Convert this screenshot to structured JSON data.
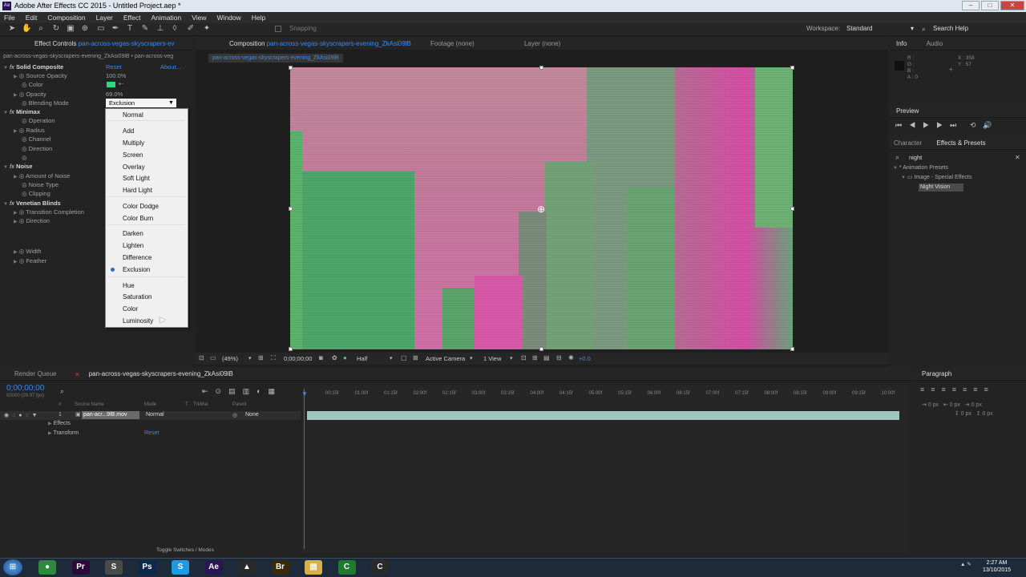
{
  "window": {
    "title": "Adobe After Effects CC 2015 - Untitled Project.aep *",
    "ae_glyph": "Ae"
  },
  "window_buttons": [
    "–",
    "□",
    "✕"
  ],
  "menu": [
    "File",
    "Edit",
    "Composition",
    "Layer",
    "Effect",
    "Animation",
    "View",
    "Window",
    "Help"
  ],
  "toolbar": {
    "snapping": "Snapping",
    "workspace_label": "Workspace:",
    "workspace_value": "Standard",
    "search_help": "Search Help"
  },
  "effect_controls": {
    "tab": "Effect Controls",
    "tab_file": "pan-across-vegas-skyscrapers-ev",
    "subtitle": "pan-across-vegas-skyscrapers-evening_ZkAsi09lB • pan-across-veg",
    "solid": {
      "name": "Solid Composite",
      "reset": "Reset",
      "about": "About...",
      "source_opacity_label": "Source Opacity",
      "source_opacity": "100.0%",
      "color_label": "Color",
      "opacity_label": "Opacity",
      "opacity": "69.0%",
      "blend_label": "Blending Mode",
      "blend_value": "Exclusion"
    },
    "minimax": {
      "name": "Minimax",
      "items": [
        "Operation",
        "Radius",
        "Channel",
        "Direction"
      ]
    },
    "noise": {
      "name": "Noise",
      "items": [
        "Amount of Noise",
        "Noise Type",
        "Clipping"
      ]
    },
    "venetian": {
      "name": "Venetian Blinds",
      "items": [
        "Transition Completion",
        "Direction",
        "Width",
        "Feather"
      ]
    }
  },
  "blend_menu": {
    "items": [
      "Normal",
      "Add",
      "Multiply",
      "Screen",
      "Overlay",
      "Soft Light",
      "Hard Light",
      "Color Dodge",
      "Color Burn",
      "Darken",
      "Lighten",
      "Difference",
      "Exclusion",
      "Hue",
      "Saturation",
      "Color",
      "Luminosity"
    ],
    "selected": "Exclusion"
  },
  "comp": {
    "tab_label": "Composition",
    "tab_file": "pan-across-vegas-skyscrapers-evening_ZkAsi09lB",
    "footage": "Footage (none)",
    "layer": "Layer (none)",
    "crumb": "pan-across-vegas-skyscrapers-evening_ZkAsi09lB",
    "zoom": "(49%)",
    "timecode": "0;00;00;00",
    "resolution": "Half",
    "camera": "Active Camera",
    "views": "1 View",
    "exposure": "+0.0"
  },
  "info": {
    "tab": "Info",
    "audio": "Audio",
    "r": "R :",
    "g": "G :",
    "b": "B :",
    "a": "A : 0",
    "x": "X : 358",
    "y": "Y : 57"
  },
  "preview": {
    "tab": "Preview"
  },
  "effects_presets": {
    "character": "Character",
    "tab": "Effects & Presets",
    "search": "night",
    "tree": [
      "* Animation Presets",
      "Image - Special Effects",
      "Night Vision"
    ]
  },
  "timeline": {
    "render_queue": "Render Queue",
    "tab": "pan-across-vegas-skyscrapers-evening_ZkAsi09lB",
    "timecode": "0;00;00;00",
    "fps": "00000 (29.97 fps)",
    "cols": [
      "#",
      "Source Name",
      "Mode",
      "T",
      "TrkMat",
      "Parent"
    ],
    "layer_num": "1",
    "layer_name": "pan-acr...9lB.mov",
    "mode": "Normal",
    "parent": "None",
    "sub": [
      "Effects",
      "Transform"
    ],
    "reset": "Reset",
    "toggle": "Toggle Switches / Modes",
    "ruler": [
      "00:15f",
      "01:00f",
      "01:15f",
      "02:00f",
      "02:15f",
      "03:00f",
      "03:15f",
      "04:00f",
      "04:15f",
      "05:00f",
      "05:15f",
      "06:00f",
      "06:15f",
      "07:00f",
      "07:15f",
      "08:00f",
      "08:15f",
      "09:00f",
      "09:15f",
      "10:00f"
    ]
  },
  "paragraph": {
    "tab": "Paragraph",
    "px": [
      "0 px",
      "0 px",
      "0 px",
      "0 px",
      "0 px"
    ]
  },
  "taskbar": {
    "time": "2:27 AM",
    "date": "13/10/2015",
    "apps": [
      {
        "name": "chrome",
        "label": "●",
        "color": "#2b8a3e"
      },
      {
        "name": "premiere",
        "label": "Pr",
        "color": "#2a0a3a"
      },
      {
        "name": "sublime",
        "label": "S",
        "color": "#4a4a4a"
      },
      {
        "name": "photoshop",
        "label": "Ps",
        "color": "#0b2a4a"
      },
      {
        "name": "skype",
        "label": "S",
        "color": "#1e9ae0"
      },
      {
        "name": "aftereffects",
        "label": "Ae",
        "color": "#2a1653"
      },
      {
        "name": "vlc",
        "label": "▲",
        "color": "#2a2a2a"
      },
      {
        "name": "bridge",
        "label": "Br",
        "color": "#3a2a0a"
      },
      {
        "name": "explorer",
        "label": "▤",
        "color": "#d8b04a"
      },
      {
        "name": "camtasia",
        "label": "C",
        "color": "#1f7a2f"
      },
      {
        "name": "camtasia2",
        "label": "C",
        "color": "#2a2a2a"
      }
    ]
  }
}
